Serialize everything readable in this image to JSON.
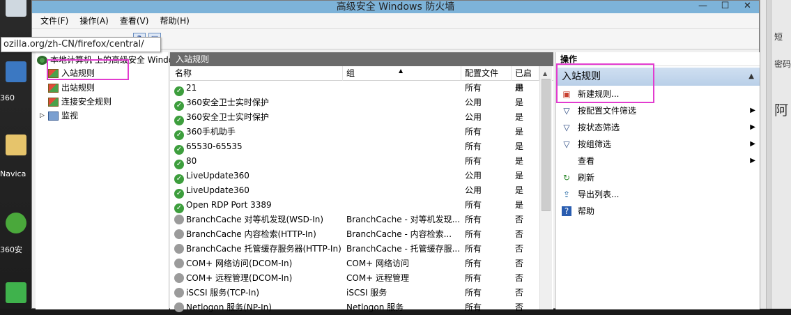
{
  "window": {
    "title": "高级安全 Windows 防火墙"
  },
  "menu": [
    "文件(F)",
    "操作(A)",
    "查看(V)",
    "帮助(H)"
  ],
  "tooltip": "ozilla.org/zh-CN/firefox/central/",
  "desktop": {
    "labels": [
      "360",
      "Navica",
      "360安"
    ]
  },
  "rightstrip": {
    "texts": [
      "短",
      "密码",
      "阿"
    ]
  },
  "tree": {
    "root": "本地计算机 上的高级安全 Windows",
    "items": [
      "入站规则",
      "出站规则",
      "连接安全规则",
      "监视"
    ]
  },
  "center": {
    "panel_title": "入站规则",
    "columns": [
      "名称",
      "组",
      "配置文件",
      "已启用"
    ],
    "rows": [
      {
        "name": "21",
        "group": "",
        "profile": "所有",
        "enabled": "是",
        "status": "on"
      },
      {
        "name": "360安全卫士实时保护",
        "group": "",
        "profile": "公用",
        "enabled": "是",
        "status": "on"
      },
      {
        "name": "360安全卫士实时保护",
        "group": "",
        "profile": "公用",
        "enabled": "是",
        "status": "on"
      },
      {
        "name": "360手机助手",
        "group": "",
        "profile": "所有",
        "enabled": "是",
        "status": "on"
      },
      {
        "name": "65530-65535",
        "group": "",
        "profile": "所有",
        "enabled": "是",
        "status": "on"
      },
      {
        "name": "80",
        "group": "",
        "profile": "所有",
        "enabled": "是",
        "status": "on"
      },
      {
        "name": "LiveUpdate360",
        "group": "",
        "profile": "公用",
        "enabled": "是",
        "status": "on"
      },
      {
        "name": "LiveUpdate360",
        "group": "",
        "profile": "公用",
        "enabled": "是",
        "status": "on"
      },
      {
        "name": "Open RDP Port 3389",
        "group": "",
        "profile": "所有",
        "enabled": "是",
        "status": "on"
      },
      {
        "name": "BranchCache 对等机发现(WSD-In)",
        "group": "BranchCache - 对等机发现...",
        "profile": "所有",
        "enabled": "否",
        "status": "off"
      },
      {
        "name": "BranchCache 内容检索(HTTP-In)",
        "group": "BranchCache - 内容检索...",
        "profile": "所有",
        "enabled": "否",
        "status": "off"
      },
      {
        "name": "BranchCache 托管缓存服务器(HTTP-In)",
        "group": "BranchCache - 托管缓存服...",
        "profile": "所有",
        "enabled": "否",
        "status": "off"
      },
      {
        "name": "COM+ 网络访问(DCOM-In)",
        "group": "COM+ 网络访问",
        "profile": "所有",
        "enabled": "否",
        "status": "off"
      },
      {
        "name": "COM+ 远程管理(DCOM-In)",
        "group": "COM+ 远程管理",
        "profile": "所有",
        "enabled": "否",
        "status": "off"
      },
      {
        "name": "iSCSI 服务(TCP-In)",
        "group": "iSCSI 服务",
        "profile": "所有",
        "enabled": "否",
        "status": "off"
      },
      {
        "name": "Netlogon 服务(NP-In)",
        "group": "Netlogon 服务",
        "profile": "所有",
        "enabled": "否",
        "status": "off"
      }
    ]
  },
  "actions": {
    "title": "操作",
    "section": "入站规则",
    "items": [
      {
        "label": "新建规则...",
        "icon": "new-rule-icon",
        "submenu": false
      },
      {
        "label": "按配置文件筛选",
        "icon": "filter-icon",
        "submenu": true
      },
      {
        "label": "按状态筛选",
        "icon": "filter-icon",
        "submenu": true
      },
      {
        "label": "按组筛选",
        "icon": "filter-icon",
        "submenu": true
      },
      {
        "label": "查看",
        "icon": "",
        "submenu": true
      },
      {
        "label": "刷新",
        "icon": "refresh-icon",
        "submenu": false
      },
      {
        "label": "导出列表...",
        "icon": "export-icon",
        "submenu": false
      },
      {
        "label": "帮助",
        "icon": "help-icon",
        "submenu": false
      }
    ]
  },
  "colors": {
    "highlight": "#e23ccf",
    "enabled": "#3d9e3d",
    "disabled": "#9b9b9b",
    "panel_header": "#6b6b6b"
  }
}
